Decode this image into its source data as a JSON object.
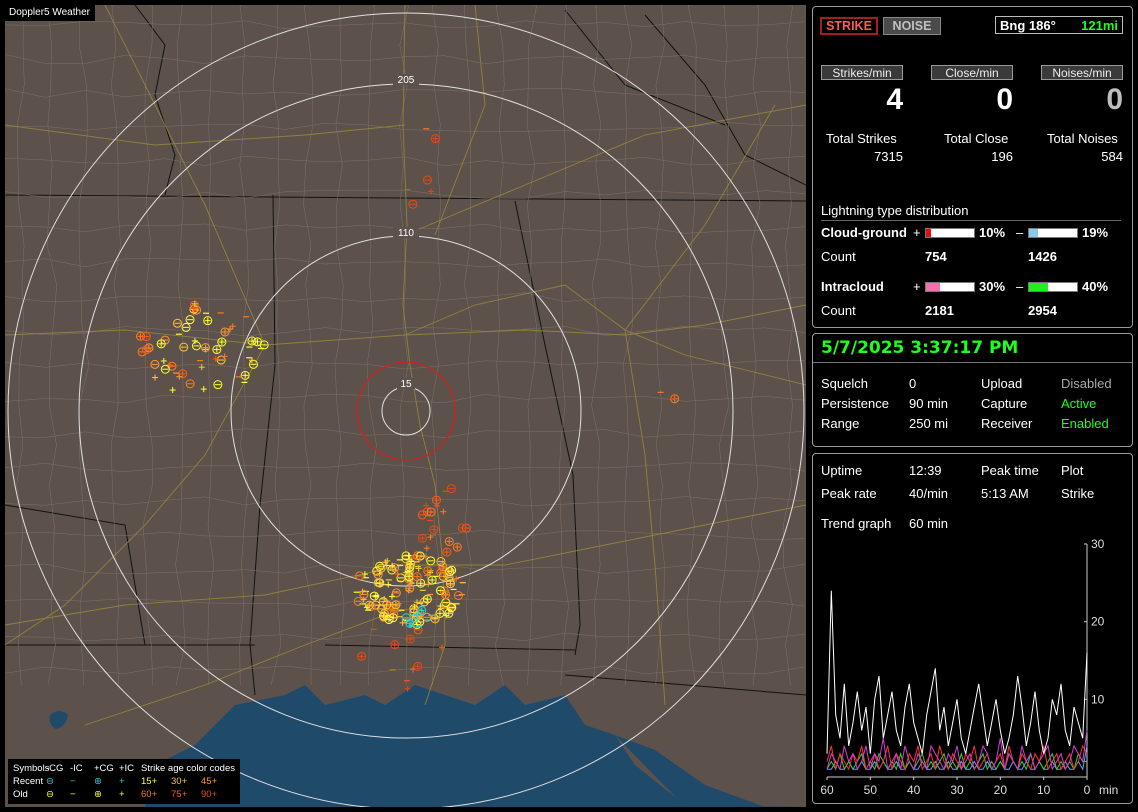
{
  "map": {
    "title": "Doppler5 Weather",
    "range_labels": [
      "205",
      "110",
      "15"
    ],
    "legend": {
      "headers": [
        "Symbols",
        "-CG",
        "-IC",
        "+CG",
        "+IC",
        "Strike age color codes"
      ],
      "rows": [
        {
          "label": "Recent",
          "ages": [
            "15+",
            "30+",
            "45+"
          ]
        },
        {
          "label": "Old",
          "ages": [
            "60+",
            "75+",
            "90+"
          ]
        }
      ],
      "age_colors": [
        "#ffff33",
        "#ffc832",
        "#ff9632",
        "#ff7a1e",
        "#ff5a14",
        "#e84a10"
      ]
    }
  },
  "status": {
    "strike_label": "STRIKE",
    "noise_label": "NOISE",
    "bearing": "Bng 186°",
    "distance": "121mi",
    "rates": [
      {
        "label": "Strikes/min",
        "value": "4",
        "total_label": "Total Strikes",
        "total": "7315"
      },
      {
        "label": "Close/min",
        "value": "0",
        "total_label": "Total Close",
        "total": "196"
      },
      {
        "label": "Noises/min",
        "value": "0",
        "total_label": "Total Noises",
        "total": "584"
      }
    ],
    "distribution": {
      "title": "Lightning type distribution",
      "cloud_ground": {
        "label": "Cloud-ground",
        "plus_pct": "10%",
        "plus_frac": 0.1,
        "minus_pct": "19%",
        "minus_frac": 0.19,
        "count_label": "Count",
        "plus_count": "754",
        "minus_count": "1426"
      },
      "intracloud": {
        "label": "Intracloud",
        "plus_pct": "30%",
        "plus_frac": 0.3,
        "minus_pct": "40%",
        "minus_frac": 0.4,
        "count_label": "Count",
        "plus_count": "2181",
        "minus_count": "2954"
      },
      "plus_sign": "+",
      "minus_sign": "–"
    }
  },
  "settings": {
    "datetime": "5/7/2025 3:37:17 PM",
    "squelch_label": "Squelch",
    "squelch": "0",
    "persistence_label": "Persistence",
    "persistence": "90 min",
    "range_label": "Range",
    "range": "250 mi",
    "upload_label": "Upload",
    "upload": "Disabled",
    "capture_label": "Capture",
    "capture": "Active",
    "receiver_label": "Receiver",
    "receiver": "Enabled"
  },
  "stats": {
    "uptime_label": "Uptime",
    "uptime": "12:39",
    "peak_time_label": "Peak time",
    "peak_time": "5:13 AM",
    "plot_label": "Plot",
    "plot": "Strike",
    "peak_rate_label": "Peak rate",
    "peak_rate": "40/min",
    "trend_label": "Trend graph",
    "trend": "60 min"
  },
  "chart_data": {
    "type": "line",
    "x_ticks": [
      "60",
      "50",
      "40",
      "30",
      "20",
      "10",
      "0"
    ],
    "x_unit": "min",
    "y_ticks": [
      "30",
      "20",
      "10"
    ],
    "ylim": [
      0,
      30
    ],
    "xlim": [
      60,
      0
    ],
    "series": [
      {
        "color": "#ffffff",
        "values": [
          3,
          24,
          8,
          5,
          12,
          4,
          7,
          11,
          6,
          9,
          3,
          10,
          13,
          5,
          8,
          11,
          6,
          4,
          9,
          12,
          7,
          5,
          3,
          8,
          11,
          14,
          6,
          9,
          4,
          7,
          10,
          5,
          3,
          6,
          9,
          12,
          8,
          4,
          7,
          10,
          6,
          3,
          5,
          8,
          13,
          9,
          4,
          7,
          11,
          6,
          3,
          5,
          10,
          8,
          12,
          6,
          4,
          9,
          7,
          5,
          16
        ]
      },
      {
        "color": "#d040d0",
        "values": [
          1,
          3,
          2,
          1,
          4,
          2,
          3,
          1,
          2,
          4,
          1,
          3,
          2,
          5,
          1,
          2,
          3,
          1,
          4,
          2,
          1,
          3,
          2,
          1,
          4,
          3,
          2,
          1,
          3,
          2,
          4,
          1,
          2,
          3,
          1,
          2,
          4,
          3,
          1,
          2,
          5,
          1,
          3,
          2,
          1,
          4,
          2,
          3,
          1,
          2,
          3,
          4,
          1,
          2,
          3,
          1,
          2,
          4,
          3,
          2,
          6
        ]
      },
      {
        "color": "#ff3030",
        "values": [
          2,
          4,
          1,
          3,
          2,
          1,
          3,
          2,
          4,
          1,
          2,
          3,
          1,
          2,
          4,
          1,
          3,
          2,
          1,
          3,
          2,
          4,
          1,
          2,
          3,
          1,
          4,
          2,
          1,
          3,
          2,
          1,
          3,
          2,
          4,
          1,
          2,
          3,
          1,
          2,
          3,
          1,
          4,
          2,
          1,
          3,
          2,
          1,
          3,
          2,
          4,
          1,
          2,
          3,
          1,
          2,
          3,
          1,
          2,
          4,
          3
        ]
      },
      {
        "color": "#30d030",
        "values": [
          1,
          2,
          1,
          3,
          1,
          2,
          1,
          2,
          3,
          1,
          2,
          1,
          3,
          2,
          1,
          2,
          1,
          3,
          1,
          2,
          1,
          2,
          3,
          1,
          2,
          1,
          2,
          3,
          1,
          2,
          1,
          3,
          1,
          2,
          1,
          2,
          3,
          1,
          2,
          1,
          2,
          1,
          3,
          2,
          1,
          2,
          1,
          3,
          1,
          2,
          1,
          2,
          3,
          1,
          2,
          1,
          2,
          1,
          3,
          2,
          2
        ]
      },
      {
        "color": "#60a0ff",
        "values": [
          1,
          1,
          2,
          1,
          1,
          2,
          1,
          1,
          2,
          1,
          1,
          2,
          1,
          2,
          1,
          1,
          2,
          1,
          1,
          2,
          1,
          1,
          2,
          1,
          1,
          2,
          1,
          1,
          2,
          1,
          1,
          2,
          1,
          1,
          2,
          1,
          1,
          2,
          1,
          1,
          2,
          1,
          1,
          2,
          1,
          1,
          2,
          1,
          1,
          2,
          1,
          1,
          2,
          1,
          1,
          2,
          1,
          1,
          2,
          1,
          4
        ]
      }
    ]
  }
}
